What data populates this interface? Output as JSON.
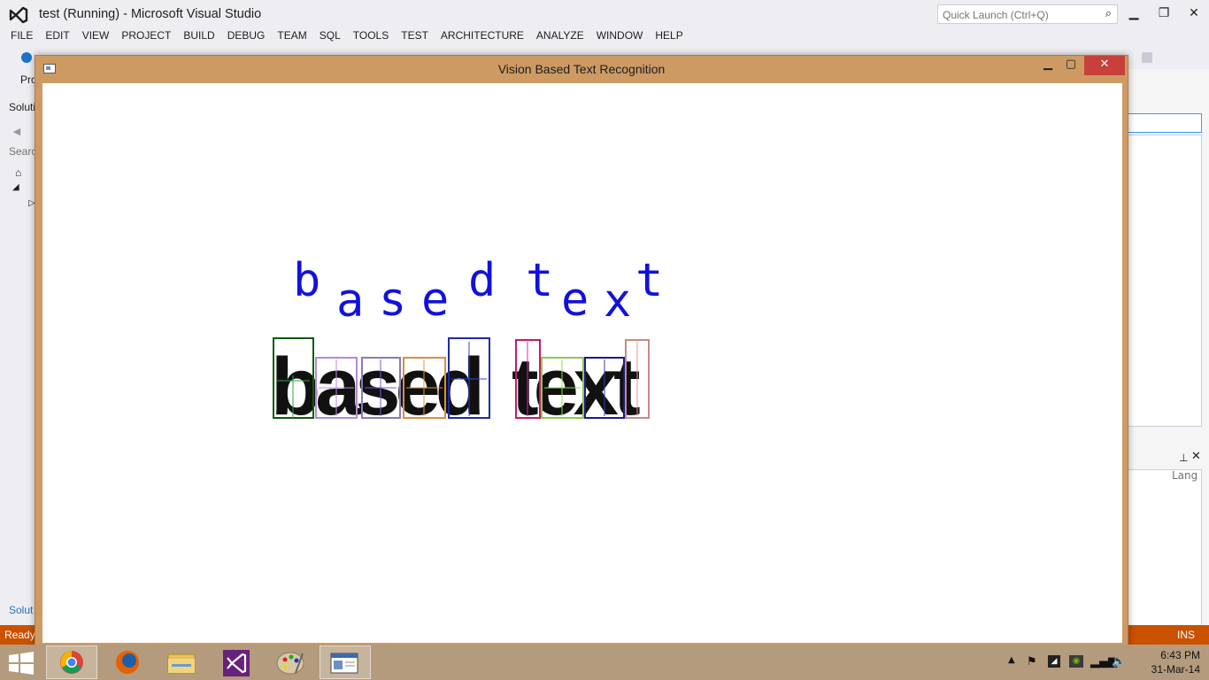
{
  "vs": {
    "title": "test (Running) - Microsoft Visual Studio",
    "quick_launch_placeholder": "Quick Launch (Ctrl+Q)",
    "menu": [
      "FILE",
      "EDIT",
      "VIEW",
      "PROJECT",
      "BUILD",
      "DEBUG",
      "TEAM",
      "SQL",
      "TOOLS",
      "TEST",
      "ARCHITECTURE",
      "ANALYZE",
      "WINDOW",
      "HELP"
    ],
    "left_panel": {
      "pro": "Pro",
      "solution_header": "Soluti",
      "search": "Searc",
      "solution_tab": "Solut"
    },
    "right_panel": {
      "lang": "Lang"
    },
    "status": "Ready",
    "ins": "INS"
  },
  "app_window": {
    "title": "Vision Based Text Recognition",
    "recognized_letters": [
      "b",
      "a",
      "s",
      "e",
      "d",
      "t",
      "e",
      "x",
      "t"
    ],
    "word_segments": [
      "based",
      "text"
    ],
    "box_colors": [
      "#0a5a0a",
      "#b48ad6",
      "#8a7ab4",
      "#d8903c",
      "#1a2aa8",
      "#c8196e",
      "#8acb4a",
      "#1a1a8c",
      "#c88a84"
    ],
    "recognized_color": "#1111dd"
  },
  "taskbar": {
    "apps": [
      "chrome",
      "firefox",
      "file-explorer",
      "visual-studio",
      "paint",
      "vision-app"
    ],
    "time": "6:43 PM",
    "date": "31-Mar-14"
  }
}
